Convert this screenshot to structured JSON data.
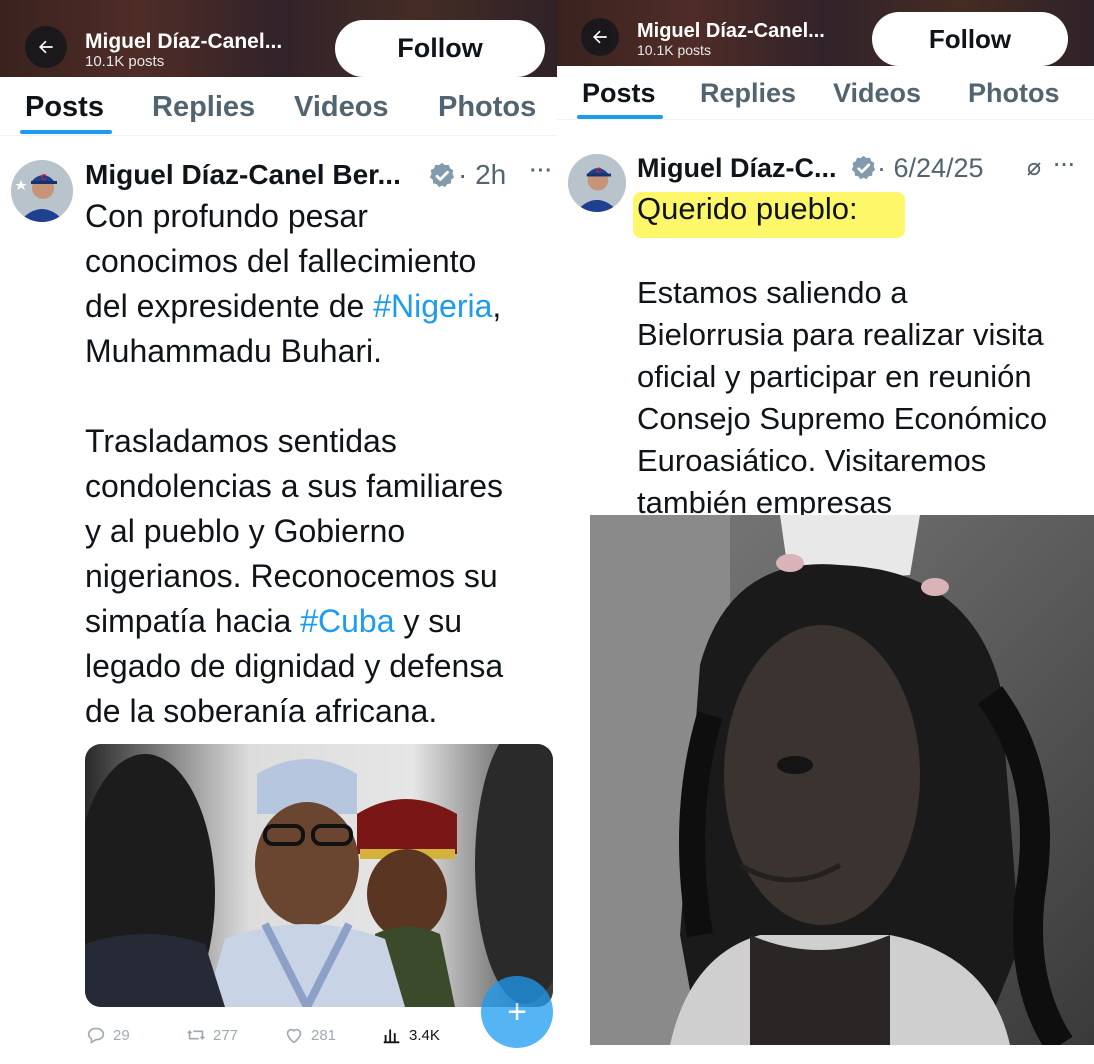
{
  "left": {
    "header": {
      "name": "Miguel Díaz-Canel...",
      "posts_count": "10.1K posts",
      "follow_label": "Follow"
    },
    "tabs": [
      {
        "label": "Posts",
        "active": true
      },
      {
        "label": "Replies",
        "active": false
      },
      {
        "label": "Videos",
        "active": false
      },
      {
        "label": "Photos",
        "active": false
      }
    ],
    "tweet": {
      "author": "Miguel Díaz-Canel Ber...",
      "time": "· 2h",
      "more": "···",
      "lines": [
        {
          "text": "Con profundo pesar"
        },
        {
          "text": "conocimos del fallecimiento"
        },
        {
          "pre": "del expresidente de ",
          "tag": "#Nigeria",
          "post": ","
        },
        {
          "text": "Muhammadu Buhari."
        },
        {
          "text": ""
        },
        {
          "text": "Trasladamos sentidas"
        },
        {
          "text": "condolencias a sus familiares"
        },
        {
          "text": "y al pueblo y Gobierno"
        },
        {
          "text": "nigerianos. Reconocemos su"
        },
        {
          "pre": "simpatía hacia ",
          "tag": "#Cuba",
          "post": " y su"
        },
        {
          "text": "legado de dignidad y defensa"
        },
        {
          "text": "de la soberanía africana."
        }
      ],
      "stats": {
        "replies": "29",
        "reposts": "277",
        "likes": "281",
        "views": "3.4K"
      },
      "fab_icon": "+"
    }
  },
  "right": {
    "header": {
      "name": "Miguel Díaz-Canel...",
      "posts_count": "10.1K posts",
      "follow_label": "Follow"
    },
    "tabs": [
      {
        "label": "Posts",
        "active": true
      },
      {
        "label": "Replies",
        "active": false
      },
      {
        "label": "Videos",
        "active": false
      },
      {
        "label": "Photos",
        "active": false
      }
    ],
    "tweet": {
      "author": "Miguel Díaz-C...",
      "time": "· 6/24/25",
      "more": "···",
      "highlighted_line": "Querido pueblo:",
      "lines": [
        "Estamos saliendo a",
        "Bielorrusia para realizar visita",
        "oficial y participar en reunión",
        "Consejo Supremo Económico",
        "Euroasiático. Visitaremos",
        "también empresas"
      ]
    }
  },
  "colors": {
    "accent": "#1d9bf0",
    "text": "#0f1419",
    "secondary": "#536471",
    "highlight": "#fff76a"
  },
  "icons": [
    "back-arrow-icon",
    "verified-badge-icon",
    "reply-icon",
    "repost-icon",
    "like-icon",
    "views-icon",
    "compose-icon",
    "grok-icon"
  ]
}
